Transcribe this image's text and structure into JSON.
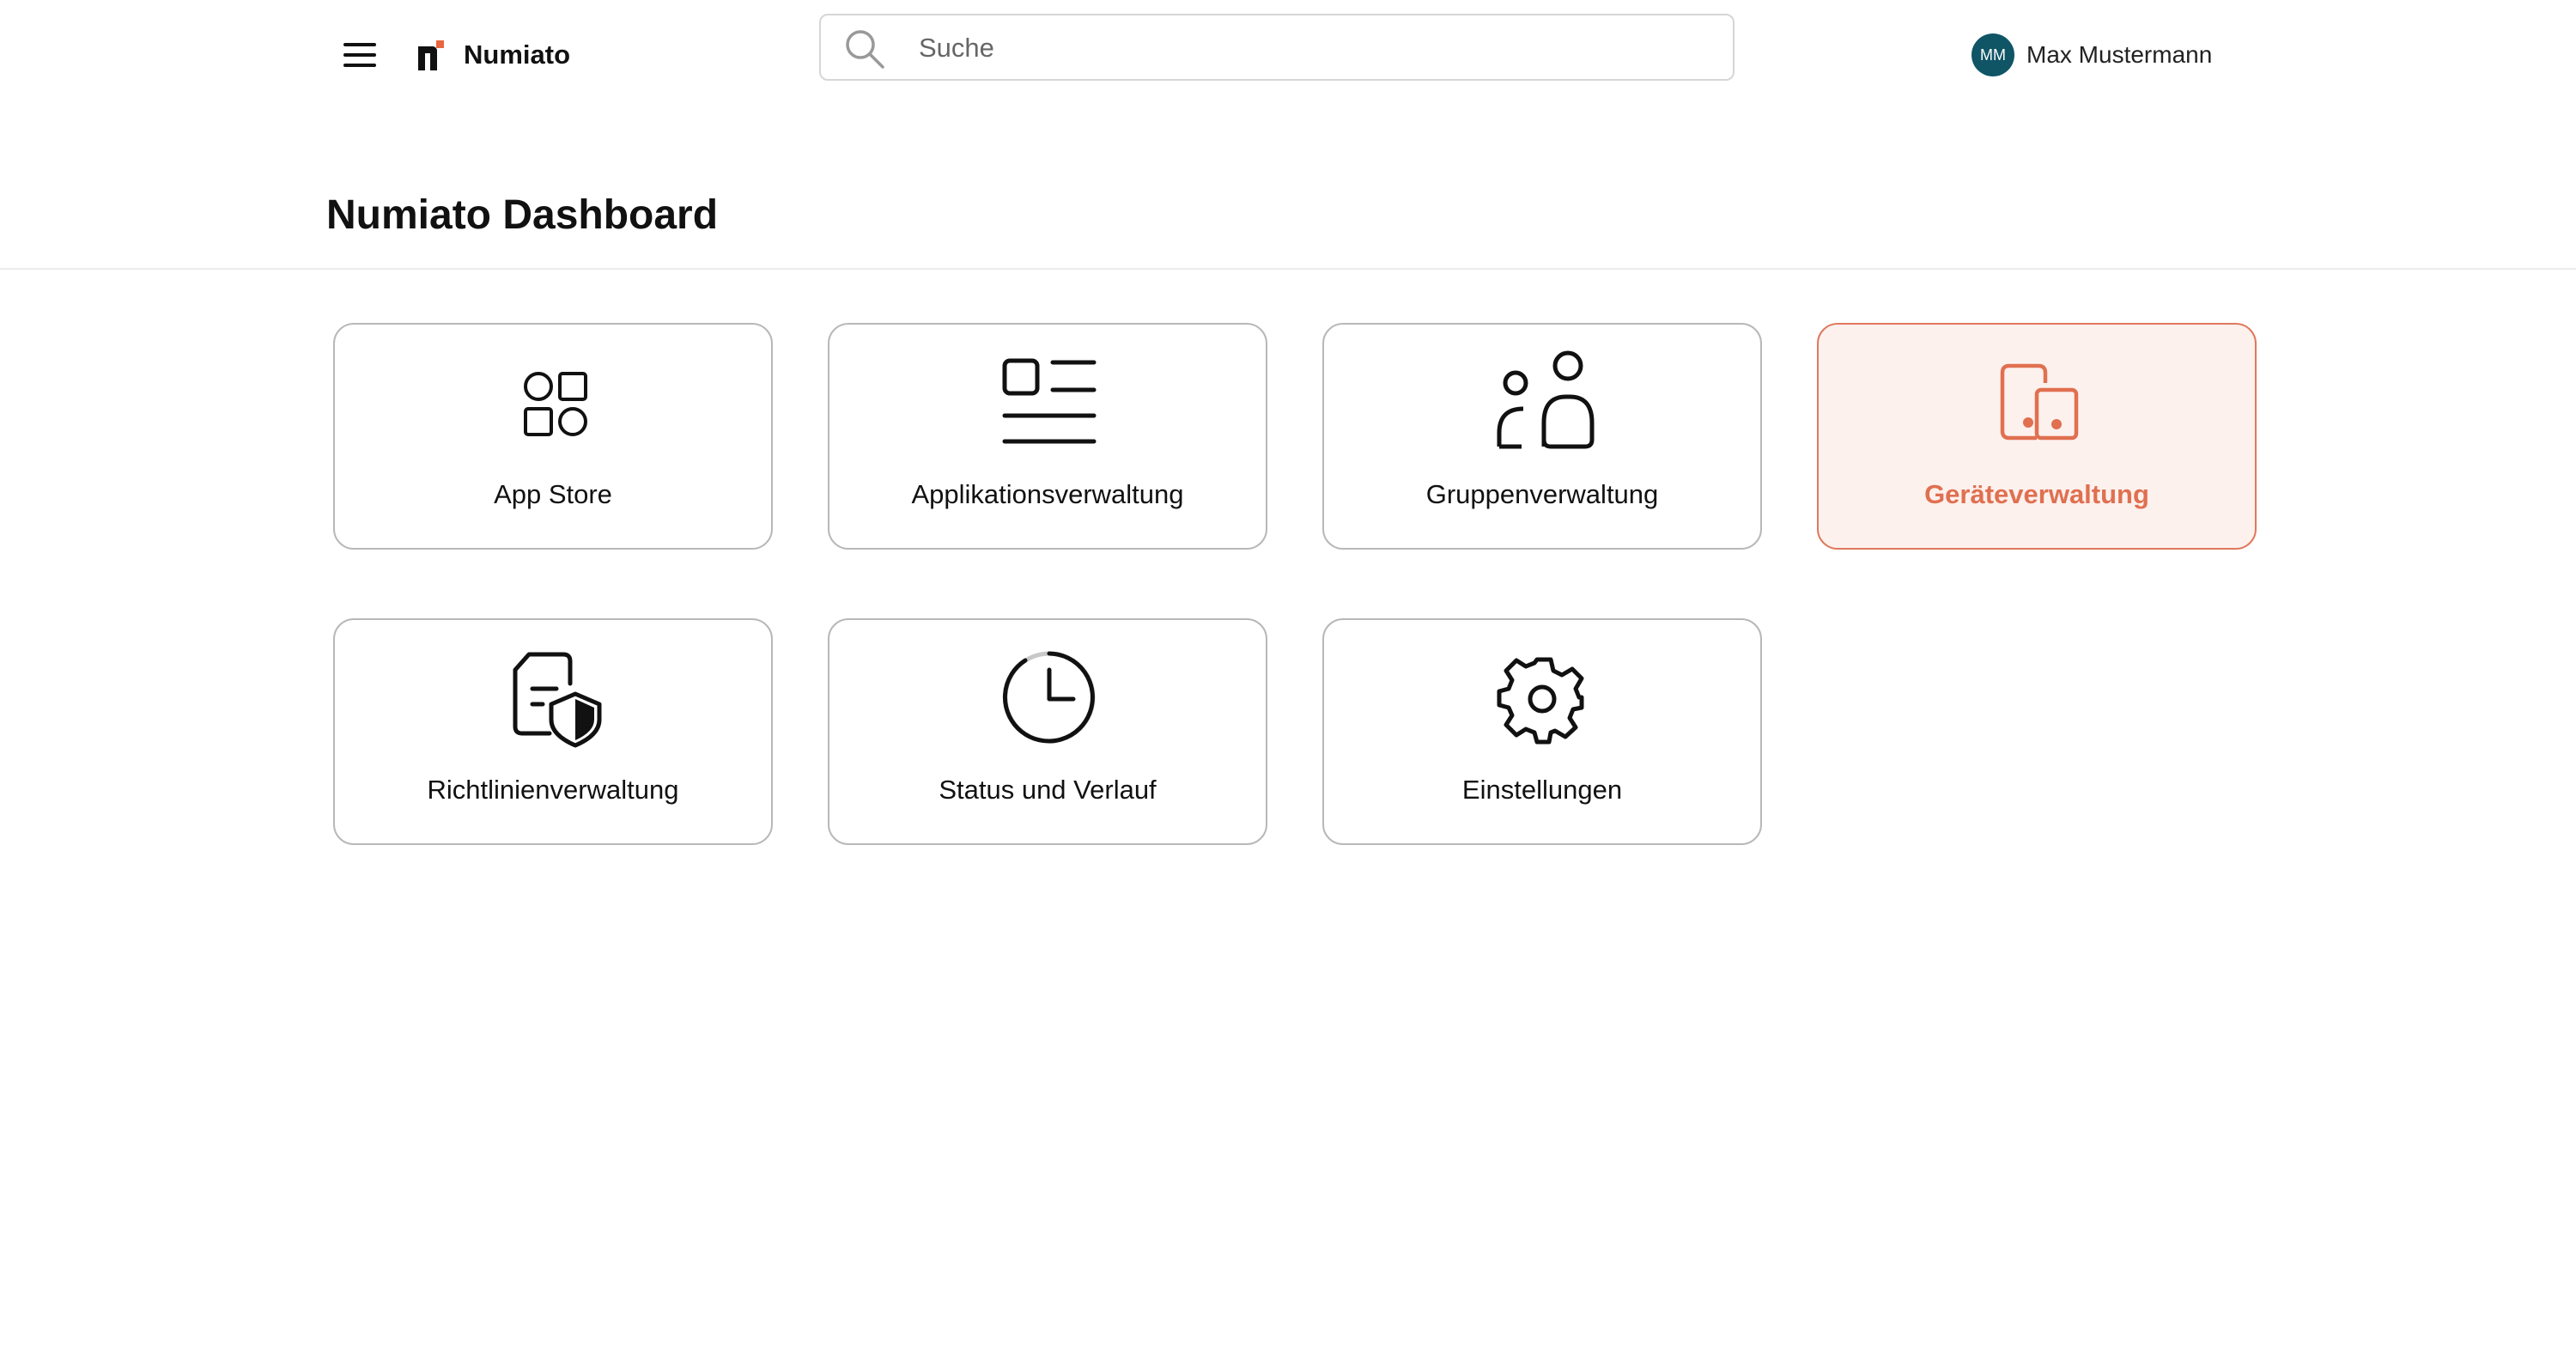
{
  "header": {
    "app_name": "Numiato",
    "menu_icon": "hamburger-menu-icon",
    "logo_icon": "numiato-logo-icon",
    "search": {
      "placeholder": "Suche",
      "value": "",
      "icon": "search-icon"
    },
    "user": {
      "initials": "MM",
      "name": "Max Mustermann",
      "avatar_color": "#0f5566"
    }
  },
  "page": {
    "title": "Numiato Dashboard"
  },
  "colors": {
    "accent": "#e07050",
    "active_background": "#fdf1ee",
    "tile_border": "#b8b8b8"
  },
  "tiles": [
    {
      "label": "App Store",
      "icon": "app-grid-icon",
      "active": false
    },
    {
      "label": "Applikationsverwaltung",
      "icon": "list-icon",
      "active": false
    },
    {
      "label": "Gruppenverwaltung",
      "icon": "people-icon",
      "active": false
    },
    {
      "label": "Geräteverwaltung",
      "icon": "devices-icon",
      "active": true
    },
    {
      "label": "Richtlinienverwaltung",
      "icon": "document-shield-icon",
      "active": false
    },
    {
      "label": "Status und Verlauf",
      "icon": "clock-icon",
      "active": false
    },
    {
      "label": "Einstellungen",
      "icon": "gear-icon",
      "active": false
    }
  ]
}
